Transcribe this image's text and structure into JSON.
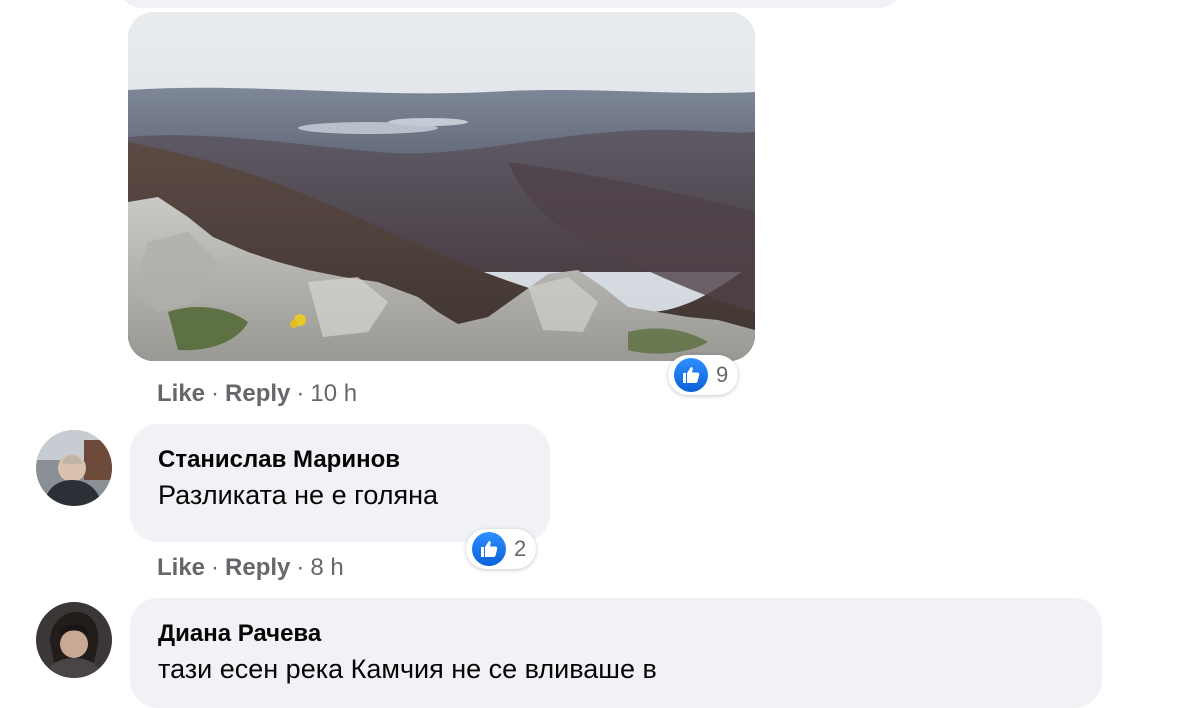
{
  "thread": {
    "photo_comment": {
      "image_alt": "mountain landscape photo",
      "reaction": {
        "icon": "like-icon",
        "count": "9"
      },
      "actions": {
        "like": "Like",
        "reply": "Reply",
        "separator": "·",
        "time": "10 h"
      }
    },
    "comments": [
      {
        "author": "Станислав Маринов",
        "text": "Разликата не е голяна",
        "reaction": {
          "icon": "like-icon",
          "count": "2"
        },
        "actions": {
          "like": "Like",
          "reply": "Reply",
          "separator": "·",
          "time": "8 h"
        }
      },
      {
        "author": "Диана Рачева",
        "text": "тази есен река Камчия не се вливаше в"
      }
    ]
  },
  "colors": {
    "bubble": "#f0f2f5",
    "muted_text": "#65676b",
    "like_blue": "#1877f2"
  }
}
